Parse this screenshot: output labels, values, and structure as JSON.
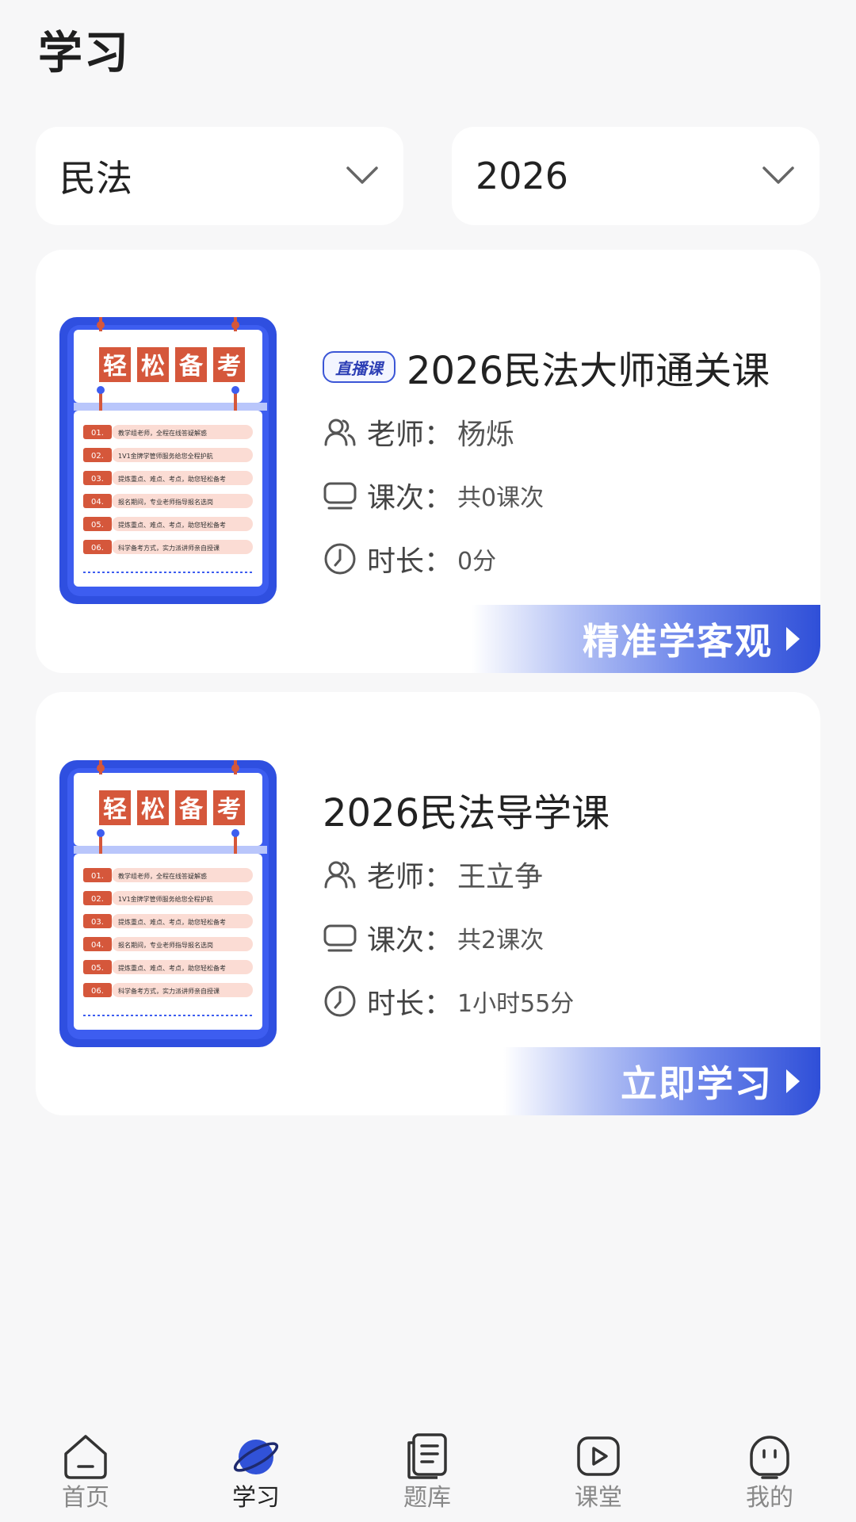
{
  "page": {
    "title": "学习"
  },
  "filters": {
    "subject": {
      "value": "民法"
    },
    "year": {
      "value": "2026"
    }
  },
  "courses": [
    {
      "badge": "直播课",
      "title": "2026民法大师通关课",
      "cover": {
        "banner": [
          "轻",
          "松",
          "备",
          "考"
        ],
        "items": [
          {
            "no": "01.",
            "text": "教学组老师，全程在线答疑解惑"
          },
          {
            "no": "02.",
            "text": "1V1金牌学管师服务给您全程护航"
          },
          {
            "no": "03.",
            "text": "提炼重点、难点、考点，助您轻松备考"
          },
          {
            "no": "04.",
            "text": "报名期间，专业老师指导报名选岗"
          },
          {
            "no": "05.",
            "text": "提炼重点、难点、考点，助您轻松备考"
          },
          {
            "no": "06.",
            "text": "科学备考方式，实力派讲师亲自授课"
          }
        ]
      },
      "teacher_label": "老师：",
      "teacher": "杨烁",
      "sessions_label": "课次：",
      "sessions": "共0课次",
      "duration_label": "时长：",
      "duration": "0分",
      "cta": "精准学客观"
    },
    {
      "badge": "",
      "title": "2026民法导学课",
      "cover": {
        "banner": [
          "轻",
          "松",
          "备",
          "考"
        ],
        "items": [
          {
            "no": "01.",
            "text": "教学组老师，全程在线答疑解惑"
          },
          {
            "no": "02.",
            "text": "1V1金牌学管师服务给您全程护航"
          },
          {
            "no": "03.",
            "text": "提炼重点、难点、考点，助您轻松备考"
          },
          {
            "no": "04.",
            "text": "报名期间，专业老师指导报名选岗"
          },
          {
            "no": "05.",
            "text": "提炼重点、难点、考点，助您轻松备考"
          },
          {
            "no": "06.",
            "text": "科学备考方式，实力派讲师亲自授课"
          }
        ]
      },
      "teacher_label": "老师：",
      "teacher": "王立争",
      "sessions_label": "课次：",
      "sessions": "共2课次",
      "duration_label": "时长：",
      "duration": "1小时55分",
      "cta": "立即学习"
    }
  ],
  "tabbar": {
    "items": [
      {
        "label": "首页",
        "icon": "home-icon"
      },
      {
        "label": "学习",
        "icon": "planet-icon",
        "active": true
      },
      {
        "label": "题库",
        "icon": "question-bank-icon"
      },
      {
        "label": "课堂",
        "icon": "play-icon"
      },
      {
        "label": "我的",
        "icon": "profile-icon"
      }
    ]
  },
  "colors": {
    "accent": "#2f4fd8",
    "background": "#f7f7f8",
    "card": "#ffffff",
    "cover_red": "#d5573b"
  }
}
